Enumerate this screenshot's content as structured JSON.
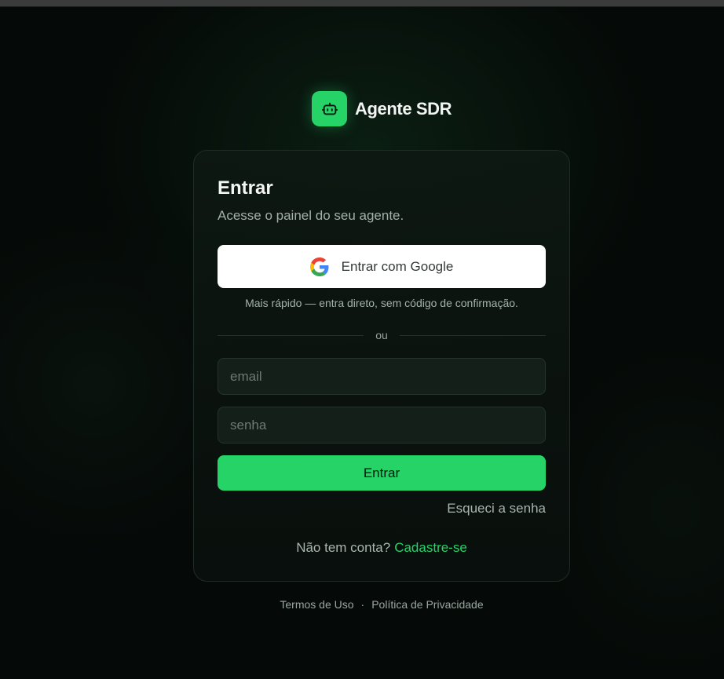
{
  "brand": {
    "name": "Agente SDR",
    "logo_icon": "robot-icon",
    "accent_color": "#25d366"
  },
  "login": {
    "title": "Entrar",
    "subtitle": "Acesse o painel do seu agente.",
    "google_button": {
      "label": "Entrar com Google",
      "icon": "google-icon"
    },
    "google_hint": "Mais rápido — entra direto, sem código de confirmação.",
    "divider_text": "ou",
    "email_placeholder": "email",
    "password_placeholder": "senha",
    "submit_label": "Entrar",
    "forgot_password": "Esqueci a senha",
    "signup_prompt": "Não tem conta?",
    "signup_link": "Cadastre-se"
  },
  "footer": {
    "terms": "Termos de Uso",
    "separator": "·",
    "privacy": "Política de Privacidade"
  }
}
